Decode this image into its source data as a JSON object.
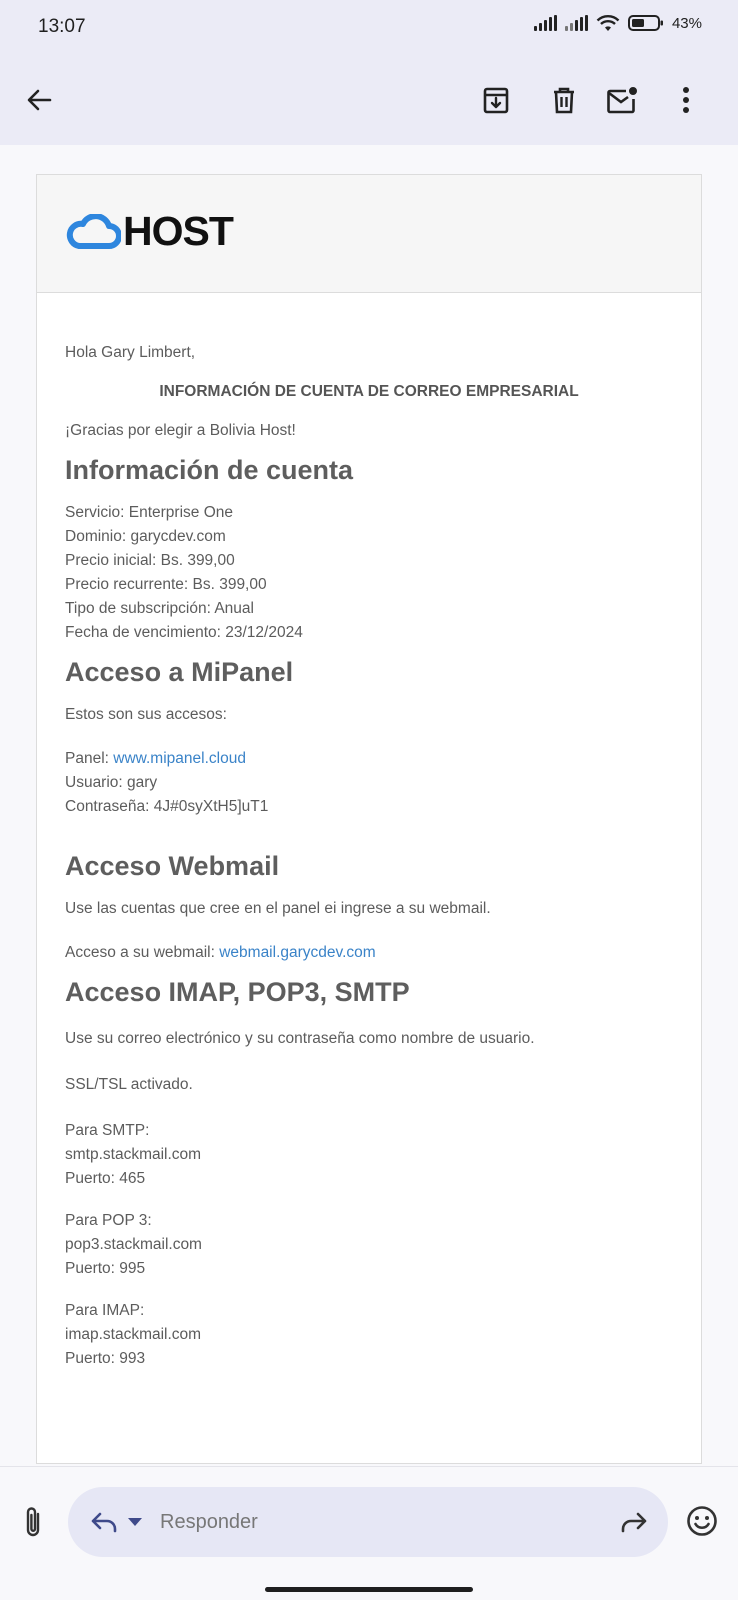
{
  "status_bar": {
    "time": "13:07",
    "battery": "43%"
  },
  "toolbar": {
    "back": "arrow-back-icon",
    "archive": "archive-icon",
    "delete": "trash-icon",
    "mark_unread": "mark-unread-icon",
    "more": "more-vert-icon"
  },
  "email": {
    "logo_text": "HOST",
    "greeting": "Hola Gary Limbert,",
    "heading_center": "INFORMACIÓN DE CUENTA DE CORREO EMPRESARIAL",
    "thanks": "¡Gracias por elegir a Bolivia Host!",
    "account": {
      "title": "Información de cuenta",
      "lines": [
        "Servicio: Enterprise One",
        "Dominio: garycdev.com",
        "Precio inicial: Bs. 399,00",
        "Precio recurrente: Bs. 399,00",
        "Tipo de subscripción: Anual",
        "Fecha de vencimiento: 23/12/2024"
      ]
    },
    "panel": {
      "title": "Acceso a MiPanel",
      "intro": "Estos son sus accesos:",
      "panel_label": "Panel: ",
      "panel_link": "www.mipanel.cloud",
      "user": "Usuario: gary",
      "password": "Contraseña: 4J#0syXtH5]uT1"
    },
    "webmail": {
      "title": "Acceso Webmail",
      "intro": "Use las cuentas que cree en el panel ei ingrese a su webmail.",
      "access_label": "Acceso a su webmail: ",
      "access_link": "webmail.garycdev.com"
    },
    "imap": {
      "title": "Acceso IMAP, POP3, SMTP",
      "intro": "Use su correo electrónico y su contraseña como nombre de usuario.",
      "ssl": "SSL/TSL activado.",
      "servers": [
        {
          "label": "Para SMTP:",
          "host": "smtp.stackmail.com",
          "port": "Puerto: 465"
        },
        {
          "label": "Para POP 3:",
          "host": "pop3.stackmail.com",
          "port": "Puerto: 995"
        },
        {
          "label": "Para IMAP:",
          "host": "imap.stackmail.com",
          "port": "Puerto: 993"
        }
      ]
    }
  },
  "reply_bar": {
    "placeholder": "Responder",
    "attach_icon": "paperclip-icon",
    "reply_icon": "reply-icon",
    "dropdown_icon": "caret-down-icon",
    "forward_icon": "forward-icon",
    "emoji_icon": "emoji-icon"
  },
  "colors": {
    "accent_link": "#3a83c8",
    "topbar": "#ebebf6",
    "logo_cloud": "#2e86de"
  }
}
